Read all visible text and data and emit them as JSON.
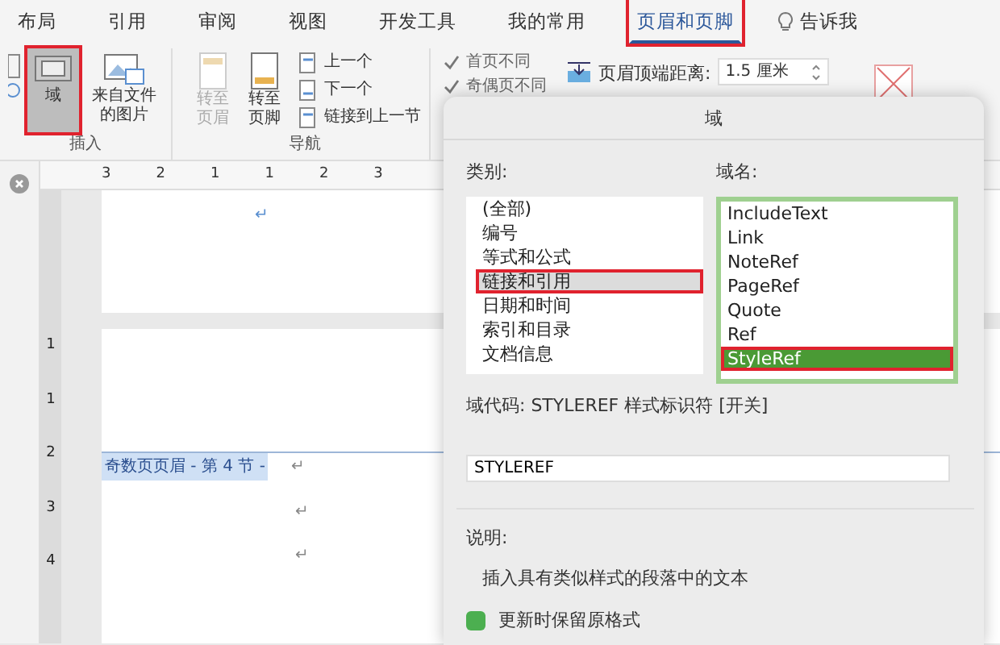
{
  "tabs": [
    {
      "label": "布局",
      "selected": false
    },
    {
      "label": "引用",
      "selected": false
    },
    {
      "label": "审阅",
      "selected": false
    },
    {
      "label": "视图",
      "selected": false
    },
    {
      "label": "开发工具",
      "selected": false
    },
    {
      "label": "我的常用",
      "selected": false
    },
    {
      "label": "页眉和页脚",
      "selected": true,
      "annotated": true
    }
  ],
  "tell_me": "告诉我",
  "ribbon": {
    "insert_group": {
      "label": "插入",
      "buttons": [
        {
          "label": "域",
          "selected": true,
          "annotated": true
        },
        {
          "label": "来自文件的图片",
          "selected": false,
          "annotated": false
        }
      ]
    },
    "nav_group": {
      "label": "导航",
      "buttons": [
        {
          "label": "转至页眉",
          "disabled": true
        },
        {
          "label": "转至页脚",
          "disabled": false
        }
      ],
      "links": [
        "上一个",
        "下一个",
        "链接到上一节"
      ]
    },
    "options": [
      {
        "label": "首页不同",
        "checked": true
      },
      {
        "label": "奇偶页不同",
        "checked": true
      }
    ],
    "header_distance": {
      "label": "页眉顶端距离:",
      "value": "1.5 厘米"
    }
  },
  "ruler": {
    "horizontal": [
      "3",
      "2",
      "1",
      "1",
      "2",
      "3"
    ],
    "vertical": [
      "1",
      "1",
      "2",
      "3",
      "4"
    ]
  },
  "document": {
    "header_label": "奇数页页眉 - 第 4 节 -",
    "marks": [
      "↵",
      "↵",
      "↵",
      "↵"
    ]
  },
  "dialog": {
    "title": "域",
    "categories_label": "类别:",
    "categories": [
      {
        "label": "(全部)",
        "selected": false,
        "annotated": false
      },
      {
        "label": "编号",
        "selected": false,
        "annotated": false
      },
      {
        "label": "等式和公式",
        "selected": false,
        "annotated": false
      },
      {
        "label": "链接和引用",
        "selected": true,
        "annotated": true
      },
      {
        "label": "日期和时间",
        "selected": false,
        "annotated": false
      },
      {
        "label": "索引和目录",
        "selected": false,
        "annotated": false
      },
      {
        "label": "文档信息",
        "selected": false,
        "annotated": false
      }
    ],
    "field_names_label": "域名:",
    "field_names": [
      {
        "label": "IncludeText",
        "selected": false,
        "annotated": false
      },
      {
        "label": "Link",
        "selected": false,
        "annotated": false
      },
      {
        "label": "NoteRef",
        "selected": false,
        "annotated": false
      },
      {
        "label": "PageRef",
        "selected": false,
        "annotated": false
      },
      {
        "label": "Quote",
        "selected": false,
        "annotated": false
      },
      {
        "label": "Ref",
        "selected": false,
        "annotated": false
      },
      {
        "label": "StyleRef",
        "selected": true,
        "annotated": true
      }
    ],
    "field_code": "域代码: STYLEREF 样式标识符 [开关]",
    "code_value": "STYLEREF",
    "description_label": "说明:",
    "description": "插入具有类似样式的段落中的文本",
    "option": {
      "label": "更新时保留原格式",
      "checked": true
    }
  }
}
